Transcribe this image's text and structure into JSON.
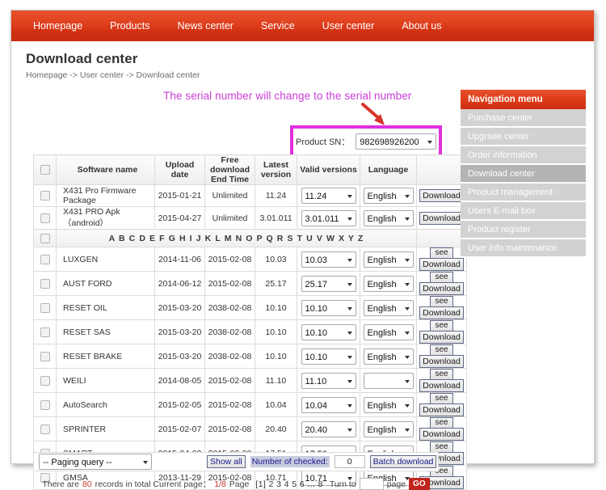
{
  "topnav": {
    "items": [
      "Homepage",
      "Products",
      "News center",
      "Service",
      "User center",
      "About us"
    ]
  },
  "header": {
    "title": "Download center",
    "breadcrumb": "Homepage -> User center -> Download center"
  },
  "annotation": {
    "text": "The serial number will change to the serial number",
    "color": "#cb3dd6",
    "box_color": "#e12fe0",
    "arrow_color": "#d9342b"
  },
  "sn": {
    "label": "Product SN：",
    "value": "982698926200"
  },
  "table": {
    "headers": [
      "",
      "Software name",
      "Upload date",
      "Free download End Time",
      "Latest version",
      "Valid versions",
      "Language",
      ""
    ],
    "alphabet": "A B C D E F G H I J K L M N O P Q R S T U V W X Y Z",
    "download_label": "Download",
    "see_label": "see",
    "top_rows": [
      {
        "name": "X431 Pro Firmware Package",
        "upload": "2015-01-21",
        "free_end": "Unlimited",
        "latest": "11.24",
        "valid": "11.24",
        "language": "English"
      },
      {
        "name": "X431 PRO Apk（android）",
        "upload": "2015-04-27",
        "free_end": "Unlimited",
        "latest": "3.01.011",
        "valid": "3.01.011",
        "language": "English"
      }
    ],
    "rows": [
      {
        "name": "LUXGEN",
        "upload": "2014-11-06",
        "free_end": "2015-02-08",
        "latest": "10.03",
        "valid": "10.03",
        "language": "English"
      },
      {
        "name": "AUST FORD",
        "upload": "2014-06-12",
        "free_end": "2015-02-08",
        "latest": "25.17",
        "valid": "25.17",
        "language": "English"
      },
      {
        "name": "RESET OIL",
        "upload": "2015-03-20",
        "free_end": "2038-02-08",
        "latest": "10.10",
        "valid": "10.10",
        "language": "English"
      },
      {
        "name": "RESET SAS",
        "upload": "2015-03-20",
        "free_end": "2038-02-08",
        "latest": "10.10",
        "valid": "10.10",
        "language": "English"
      },
      {
        "name": "RESET BRAKE",
        "upload": "2015-03-20",
        "free_end": "2038-02-08",
        "latest": "10.10",
        "valid": "10.10",
        "language": "English"
      },
      {
        "name": "WEILI",
        "upload": "2014-08-05",
        "free_end": "2015-02-08",
        "latest": "11.10",
        "valid": "11.10",
        "language": ""
      },
      {
        "name": "AutoSearch",
        "upload": "2015-02-05",
        "free_end": "2015-02-08",
        "latest": "10.04",
        "valid": "10.04",
        "language": "English"
      },
      {
        "name": "SPRINTER",
        "upload": "2015-02-07",
        "free_end": "2015-02-08",
        "latest": "20.40",
        "valid": "20.40",
        "language": "English"
      },
      {
        "name": "SMART",
        "upload": "2015-04-02",
        "free_end": "2015-02-08",
        "latest": "17.51",
        "valid": "17.50",
        "language": "English"
      },
      {
        "name": "GMSA",
        "upload": "2013-11-29",
        "free_end": "2015-02-08",
        "latest": "10.71",
        "valid": "10.71",
        "language": "English"
      }
    ]
  },
  "toolbar": {
    "paging_query": "-- Paging query --",
    "show_all": "Show all",
    "checked_label": "Number of checked:",
    "checked_count": "0",
    "batch_download": "Batch download"
  },
  "pagination": {
    "prefix": "There are",
    "total_records": "80",
    "middle": "records in total Current page：",
    "current_page": "1/8",
    "page_word": "Page",
    "page_numbers": "[1] 2 3 4 5 6 ... 8",
    "turn_to": "Turn to",
    "turn_value": "",
    "page_suffix": "page",
    "go": "GO"
  },
  "sidebar": {
    "title": "Navigation menu",
    "items": [
      {
        "label": "Purchase center",
        "active": false
      },
      {
        "label": "Upgrade center",
        "active": false
      },
      {
        "label": "Order information",
        "active": false
      },
      {
        "label": "Download center",
        "active": true
      },
      {
        "label": "Product management",
        "active": false
      },
      {
        "label": "Users E-mail box",
        "active": false
      },
      {
        "label": "Product register",
        "active": false
      },
      {
        "label": "User info maintenance",
        "active": false
      }
    ]
  }
}
